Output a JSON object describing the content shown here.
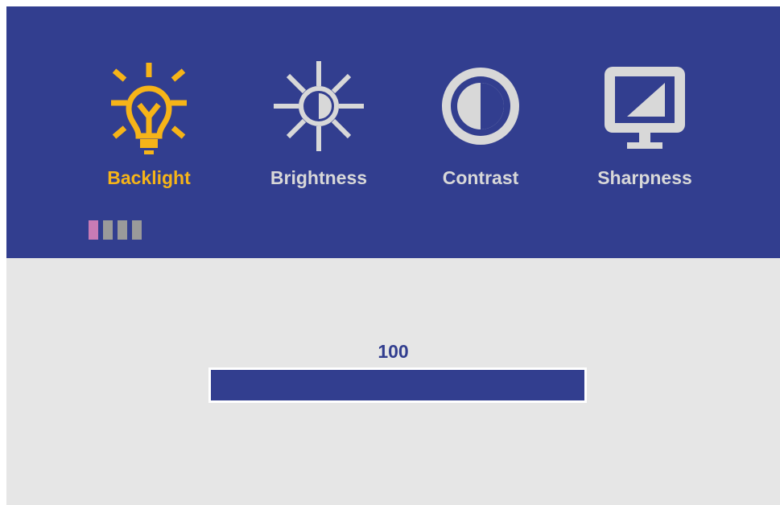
{
  "menu": {
    "items": [
      {
        "label": "Backlight",
        "icon": "lightbulb-icon",
        "selected": true
      },
      {
        "label": "Brightness",
        "icon": "sun-icon",
        "selected": false
      },
      {
        "label": "Contrast",
        "icon": "contrast-icon",
        "selected": false
      },
      {
        "label": "Sharpness",
        "icon": "monitor-sharpness-icon",
        "selected": false
      }
    ],
    "pages": {
      "total": 4,
      "current": 1
    }
  },
  "adjustment": {
    "value": "100",
    "fill_percent": 100
  },
  "colors": {
    "header_bg": "#323e8f",
    "content_bg": "#e6e6e6",
    "selected": "#f6b418",
    "inactive": "#d8d8d8",
    "page_active": "#c97bb5",
    "page_inactive": "#9a9a9a"
  }
}
